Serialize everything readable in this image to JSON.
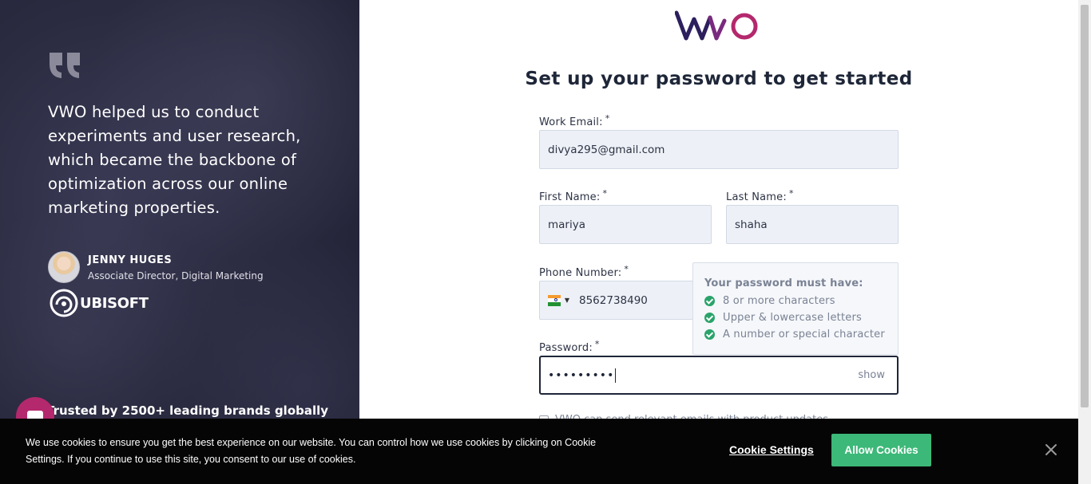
{
  "left_panel": {
    "quote": "VWO helped us to conduct experiments and user research, which became the backbone of optimization across our online marketing properties.",
    "person_name": "JENNY HUGES",
    "person_role": "Associate Director, Digital Marketing",
    "company_logo_text": "UBISOFT",
    "trusted_text": "Trusted by 2500+ leading brands globally"
  },
  "brand": {
    "logo_text": "VWO",
    "logo_colors": [
      "#2d1f5e",
      "#b4286d"
    ]
  },
  "form": {
    "title": "Set up your password to get started",
    "required_mark": "*",
    "email_label": "Work Email:",
    "email_value": "divya295@gmail.com",
    "first_name_label": "First Name:",
    "first_name_value": "mariya",
    "last_name_label": "Last Name:",
    "last_name_value": "shaha",
    "phone_label": "Phone Number:",
    "phone_country": "India",
    "phone_value": "8562738490",
    "password_label": "Password:",
    "password_masked": "•••••••••",
    "password_toggle": "show",
    "password_rules": {
      "heading": "Your password must have:",
      "items": [
        "8 or more characters",
        "Upper & lowercase letters",
        "A number or special character"
      ]
    },
    "terms_partial": "VWO can send relevant emails with product updates"
  },
  "cookie_banner": {
    "text": "We use cookies to ensure you get the best experience on our website. You can control how we use cookies by clicking on Cookie Settings. If you continue to use this site, you consent to our use of cookies.",
    "settings_label": "Cookie Settings",
    "allow_label": "Allow Cookies"
  },
  "colors": {
    "accent_green": "#3cb878",
    "check_green": "#2aa36b",
    "left_bg": "#2a2a40"
  }
}
